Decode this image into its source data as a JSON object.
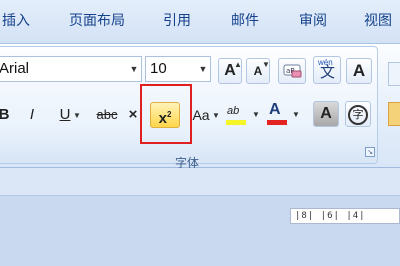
{
  "tabs": [
    "插入",
    "页面布局",
    "引用",
    "邮件",
    "审阅",
    "视图"
  ],
  "font": {
    "name_value": "Arial",
    "size_value": "10",
    "group_label": "字体",
    "launcher_icon": "dialog-launcher-icon"
  },
  "buttons": {
    "grow": "A",
    "shrink": "A",
    "clear_format_icon": "eraser-icon",
    "pinyin": "文",
    "pinyin_top": "wén",
    "border_char": "A",
    "bold": "B",
    "italic": "I",
    "underline": "U",
    "strike": "abc",
    "subscript": "×",
    "superscript_base": "x",
    "superscript_exp": "2",
    "change_case": "Aa",
    "highlight": "ab",
    "font_color": "A",
    "shading_char": "A",
    "enclose_char": "字"
  },
  "colors": {
    "highlight": "#f5f529",
    "font_color": "#e32222",
    "selection_box": "#e02020"
  },
  "ruler": "|8|  |6|  |4|"
}
